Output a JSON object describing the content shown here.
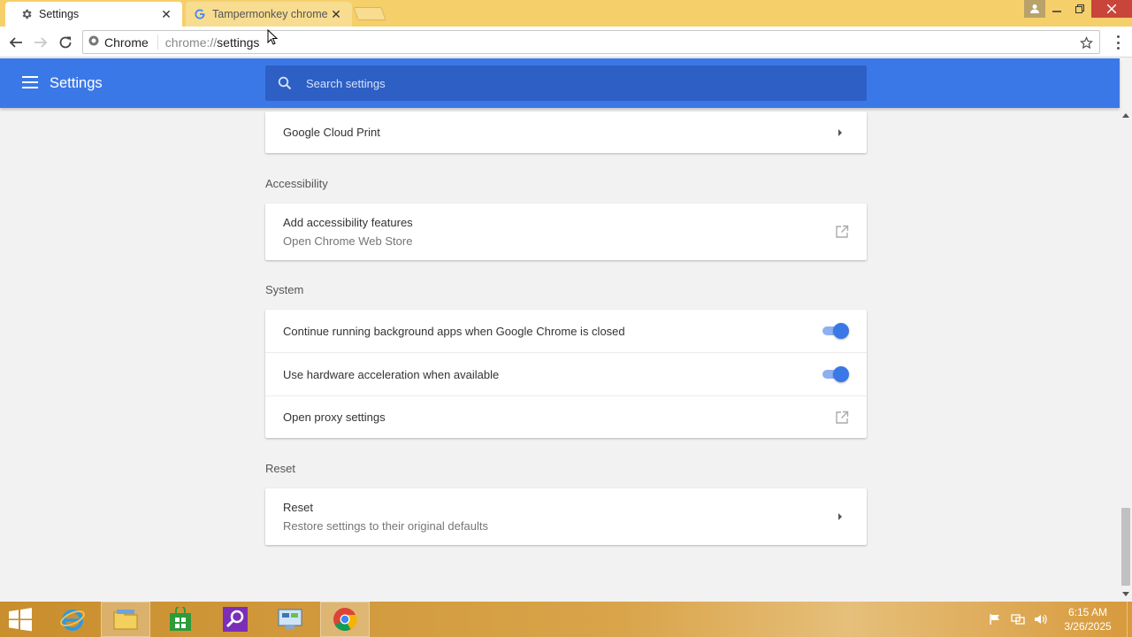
{
  "window": {
    "tabs": [
      {
        "title": "Settings",
        "icon": "gear-icon",
        "active": true
      },
      {
        "title": "Tampermonkey chrome",
        "icon": "google-g-icon",
        "active": false
      }
    ],
    "controls": [
      "user-icon",
      "minimize-icon",
      "restore-icon",
      "close-icon"
    ]
  },
  "toolbar": {
    "secure_label": "Chrome",
    "url_scheme": "chrome://",
    "url_rest": "settings"
  },
  "header": {
    "title": "Settings",
    "search_placeholder": "Search settings"
  },
  "sections": {
    "cloud_print": {
      "label": "Google Cloud Print"
    },
    "accessibility": {
      "title": "Accessibility",
      "item_label": "Add accessibility features",
      "item_sub": "Open Chrome Web Store"
    },
    "system": {
      "title": "System",
      "items": [
        {
          "label": "Continue running background apps when Google Chrome is closed",
          "enabled": true
        },
        {
          "label": "Use hardware acceleration when available",
          "enabled": true
        },
        {
          "label": "Open proxy settings"
        }
      ]
    },
    "reset": {
      "title": "Reset",
      "item_label": "Reset",
      "item_sub": "Restore settings to their original defaults"
    }
  },
  "taskbar": {
    "apps": [
      "internet-explorer-icon",
      "file-explorer-icon",
      "store-icon",
      "search-app-icon",
      "control-panel-icon",
      "chrome-icon"
    ],
    "time": "6:15 AM",
    "date": "3/26/2025"
  },
  "colors": {
    "accent": "#3b78e7",
    "header_search": "#2d5fc4",
    "titlebar": "#f5cf6a"
  }
}
